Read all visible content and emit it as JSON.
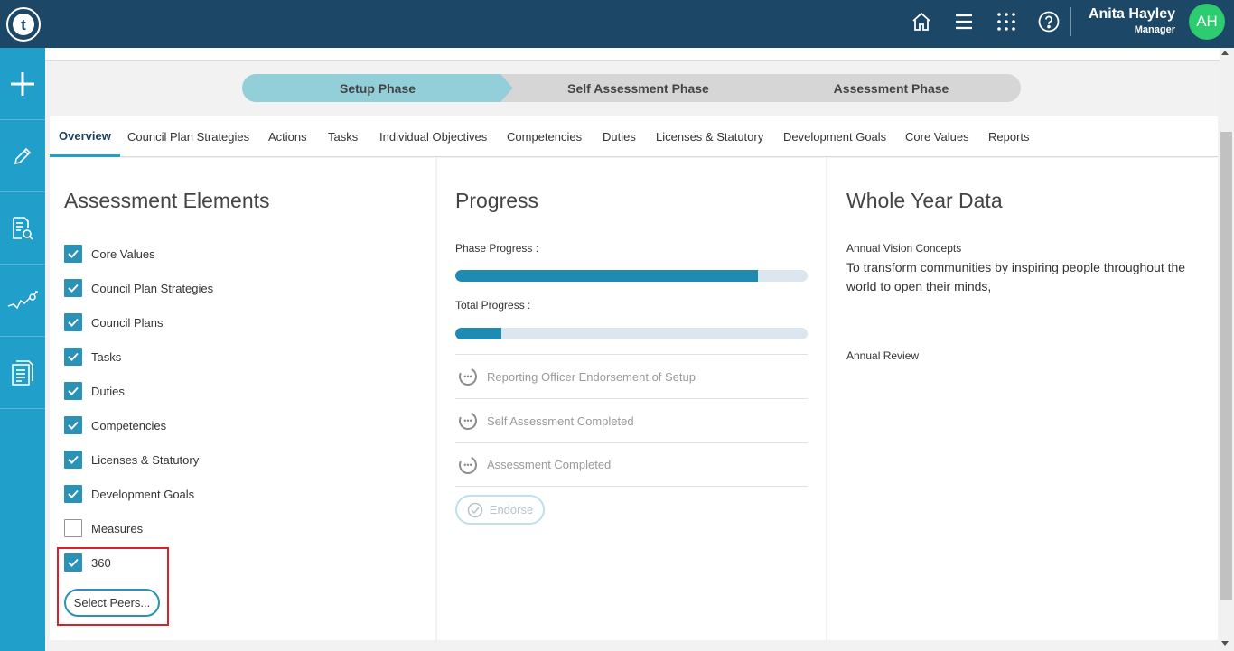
{
  "app": {
    "logo_letter": "t"
  },
  "header": {
    "user_name": "Anita Hayley",
    "user_role": "Manager",
    "avatar_initials": "AH",
    "icons": [
      "home-icon",
      "menu-icon",
      "apps-grid-icon",
      "help-icon"
    ]
  },
  "sidebar": {
    "items": [
      {
        "icon": "plus-icon"
      },
      {
        "icon": "pencil-icon"
      },
      {
        "icon": "document-search-icon"
      },
      {
        "icon": "trend-chart-icon"
      },
      {
        "icon": "documents-icon"
      }
    ]
  },
  "phases": {
    "setup": "Setup Phase",
    "self_assessment": "Self Assessment Phase",
    "assessment": "Assessment Phase"
  },
  "tabs": [
    {
      "label": "Overview",
      "active": true
    },
    {
      "label": "Council Plan Strategies"
    },
    {
      "label": "Actions"
    },
    {
      "label": "Tasks"
    },
    {
      "label": "Individual Objectives"
    },
    {
      "label": "Competencies"
    },
    {
      "label": "Duties"
    },
    {
      "label": "Licenses & Statutory"
    },
    {
      "label": "Development Goals"
    },
    {
      "label": "Core Values"
    },
    {
      "label": "Reports"
    }
  ],
  "assessment_elements": {
    "title": "Assessment Elements",
    "items": [
      {
        "label": "Core Values",
        "checked": true
      },
      {
        "label": "Council Plan Strategies",
        "checked": true
      },
      {
        "label": "Council Plans",
        "checked": true
      },
      {
        "label": "Tasks",
        "checked": true
      },
      {
        "label": "Duties",
        "checked": true
      },
      {
        "label": "Competencies",
        "checked": true
      },
      {
        "label": "Licenses & Statutory",
        "checked": true
      },
      {
        "label": "Development Goals",
        "checked": true
      },
      {
        "label": "Measures",
        "checked": false
      },
      {
        "label": "360",
        "checked": true
      }
    ],
    "select_peers_label": "Select Peers..."
  },
  "progress": {
    "title": "Progress",
    "phase_label": "Phase Progress :",
    "phase_value": 0.86,
    "total_label": "Total Progress :",
    "total_value": 0.13,
    "steps": [
      {
        "label": "Reporting Officer Endorsement of Setup"
      },
      {
        "label": "Self Assessment Completed"
      },
      {
        "label": "Assessment Completed"
      }
    ],
    "endorse_label": "Endorse"
  },
  "whole_year": {
    "title": "Whole Year Data",
    "vision_label": "Annual Vision Concepts",
    "vision_text": "To transform communities by inspiring people throughout the world to open their minds,",
    "review_label": "Annual Review"
  },
  "colors": {
    "header_bg": "#1c4766",
    "sidebar_bg": "#1f9fc9",
    "accent": "#2a91b7",
    "active_phase": "#93cfd9",
    "avatar_bg": "#2ecc71",
    "highlight": "#d9212b"
  }
}
